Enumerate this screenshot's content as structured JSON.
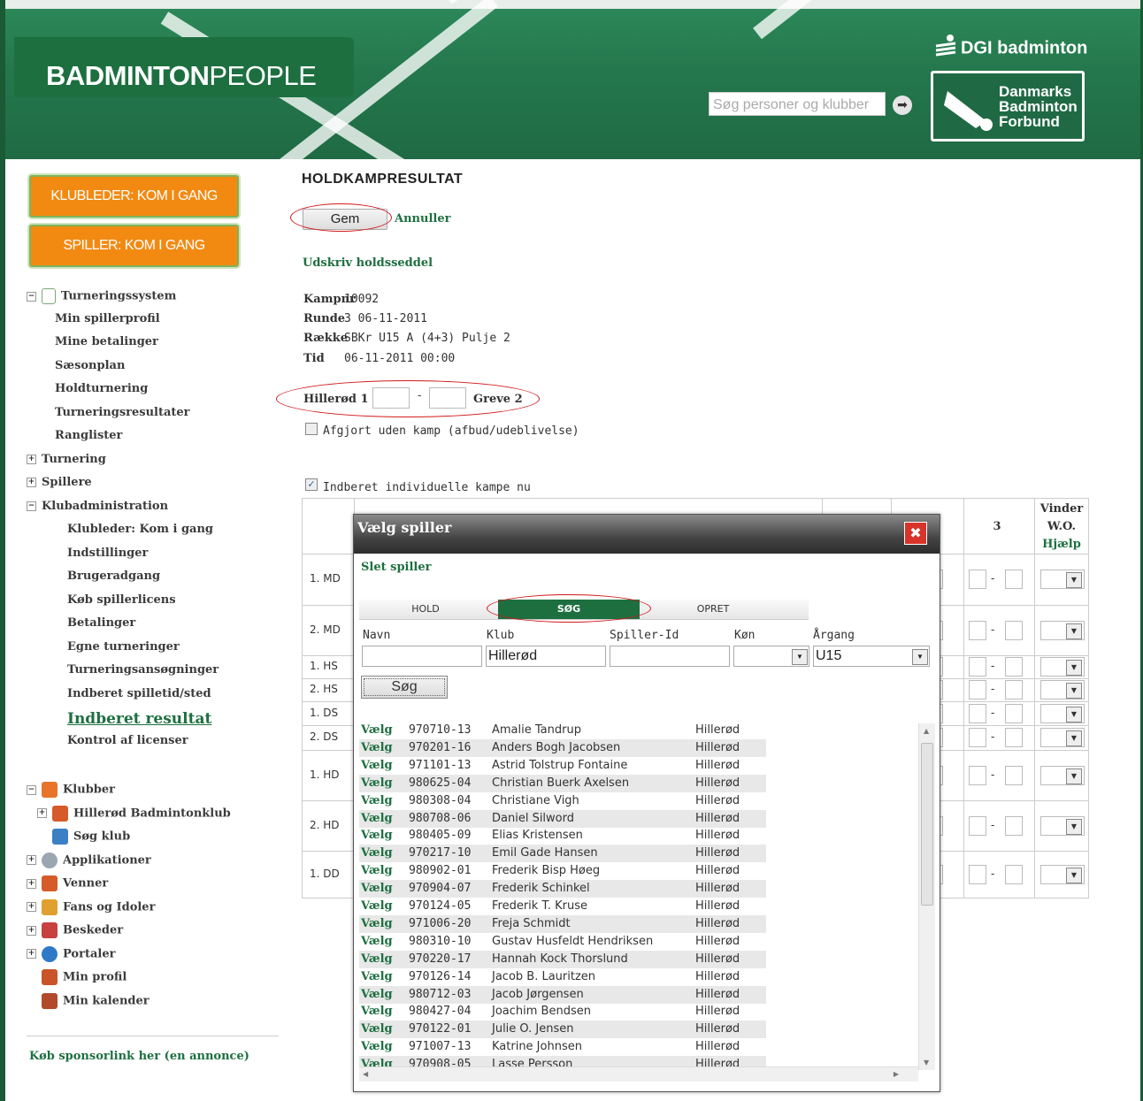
{
  "site": {
    "logo_bold": "BADMINTON",
    "logo_light": "PEOPLE",
    "search_placeholder": "Søg personer og klubber",
    "dgi": "DGI badminton",
    "dbf": "Danmarks\nBadminton\nForbund"
  },
  "sidebar": {
    "btn_klubleder": "KLUBLEDER: KOM I GANG",
    "btn_spiller": "SPILLER: KOM I GANG",
    "tree": [
      {
        "label": "Turneringssystem",
        "level": 0,
        "toggle": "⊟",
        "icon": "calendar-icon"
      },
      {
        "label": "Min spillerprofil",
        "level": 1
      },
      {
        "label": "Mine betalinger",
        "level": 1
      },
      {
        "label": "Sæsonplan",
        "level": 1
      },
      {
        "label": "Holdturnering",
        "level": 1
      },
      {
        "label": "Turneringsresultater",
        "level": 1
      },
      {
        "label": "Ranglister",
        "level": 1
      },
      {
        "label": "Turnering",
        "level": 0,
        "toggle": "⊞"
      },
      {
        "label": "Spillere",
        "level": 0,
        "toggle": "⊞"
      },
      {
        "label": "Klubadministration",
        "level": 0,
        "toggle": "⊟"
      },
      {
        "label": "Klubleder: Kom i gang",
        "level": 2
      },
      {
        "label": "Indstillinger",
        "level": 2
      },
      {
        "label": "Brugeradgang",
        "level": 2
      },
      {
        "label": "Køb spillerlicens",
        "level": 2
      },
      {
        "label": "Betalinger",
        "level": 2
      },
      {
        "label": "Egne turneringer",
        "level": 2
      },
      {
        "label": "Turneringsansøgninger",
        "level": 2
      },
      {
        "label": "Indberet spilletid/sted",
        "level": 2
      },
      {
        "label": "Indberet resultat",
        "level": 2,
        "active": true
      },
      {
        "label": "Kontrol af licenser",
        "level": 2
      }
    ],
    "tree2": [
      {
        "label": "Klubber",
        "toggle": "⊟",
        "icon": "calendar-icon"
      },
      {
        "label": "Hillerød Badmintonklub",
        "toggle": "⊞",
        "icon": "people-icon",
        "indent": true
      },
      {
        "label": "Søg klub",
        "icon": "magnifier-icon",
        "indent": true
      },
      {
        "label": "Applikationer",
        "toggle": "⊞",
        "icon": "disc-icon"
      },
      {
        "label": "Venner",
        "toggle": "⊞",
        "icon": "people-icon"
      },
      {
        "label": "Fans og Idoler",
        "toggle": "⊞",
        "icon": "thumbs-up-icon"
      },
      {
        "label": "Beskeder",
        "toggle": "⊞",
        "icon": "message-icon"
      },
      {
        "label": "Portaler",
        "toggle": "⊞",
        "icon": "globe-icon"
      },
      {
        "label": "Min profil",
        "icon": "person-icon"
      },
      {
        "label": "Min kalender",
        "icon": "calendar-day-icon"
      }
    ],
    "sponsor": "Køb sponsorlink her (en annonce)"
  },
  "main": {
    "title": "HOLDKAMPRESULTAT",
    "gem": "Gem",
    "annuller": "Annuller",
    "udskriv": "Udskriv holdsseddel",
    "info": [
      {
        "k": "Kampnr",
        "v": "10092"
      },
      {
        "k": "Runde",
        "v": "3 06-11-2011"
      },
      {
        "k": "Række",
        "v": "SBKr U15 A (4+3) Pulje 2"
      },
      {
        "k": "Tid",
        "v": "06-11-2011 00:00"
      }
    ],
    "home_team": "Hillerød 1",
    "away_team": "Greve 2",
    "score_sep": "-",
    "afgjort": "Afgjort uden kamp (afbud/udeblivelse)",
    "indberet": "Indberet individuelle kampe nu",
    "table": {
      "col3": "3",
      "vinder": "Vinder",
      "wo": "W.O.",
      "hjaelp": "Hjælp",
      "rows": [
        "1. MD",
        "2. MD",
        "1. HS",
        "2. HS",
        "1. DS",
        "2. DS",
        "1. HD",
        "2. HD",
        "1. DD"
      ]
    }
  },
  "dialog": {
    "title": "Vælg spiller",
    "slet": "Slet spiller",
    "tabs": [
      "HOLD",
      "SØG",
      "OPRET"
    ],
    "active_tab": "SØG",
    "labels": {
      "navn": "Navn",
      "klub": "Klub",
      "spillerid": "Spiller-Id",
      "kon": "Køn",
      "argang": "Årgang"
    },
    "values": {
      "navn": "",
      "klub": "Hillerød",
      "spillerid": "",
      "kon": "",
      "argang": "U15"
    },
    "sog_btn": "Søg",
    "choose": "Vælg",
    "players": [
      {
        "id": "970710-13",
        "name": "Amalie Tandrup",
        "club": "Hillerød"
      },
      {
        "id": "970201-16",
        "name": "Anders Bogh Jacobsen",
        "club": "Hillerød"
      },
      {
        "id": "971101-13",
        "name": "Astrid Tolstrup Fontaine",
        "club": "Hillerød"
      },
      {
        "id": "980625-04",
        "name": "Christian Buerk Axelsen",
        "club": "Hillerød"
      },
      {
        "id": "980308-04",
        "name": "Christiane Vigh",
        "club": "Hillerød"
      },
      {
        "id": "980708-06",
        "name": "Daniel Silword",
        "club": "Hillerød"
      },
      {
        "id": "980405-09",
        "name": "Elias Kristensen",
        "club": "Hillerød"
      },
      {
        "id": "970217-10",
        "name": "Emil Gade Hansen",
        "club": "Hillerød"
      },
      {
        "id": "980902-01",
        "name": "Frederik Bisp Høeg",
        "club": "Hillerød"
      },
      {
        "id": "970904-07",
        "name": "Frederik Schinkel",
        "club": "Hillerød"
      },
      {
        "id": "970124-05",
        "name": "Frederik T. Kruse",
        "club": "Hillerød"
      },
      {
        "id": "971006-20",
        "name": "Freja Schmidt",
        "club": "Hillerød"
      },
      {
        "id": "980310-10",
        "name": "Gustav Husfeldt Hendriksen",
        "club": "Hillerød"
      },
      {
        "id": "970220-17",
        "name": "Hannah Kock Thorslund",
        "club": "Hillerød"
      },
      {
        "id": "970126-14",
        "name": "Jacob B. Lauritzen",
        "club": "Hillerød"
      },
      {
        "id": "980712-03",
        "name": "Jacob Jørgensen",
        "club": "Hillerød"
      },
      {
        "id": "980427-04",
        "name": "Joachim Bendsen",
        "club": "Hillerød"
      },
      {
        "id": "970122-01",
        "name": "Julie O. Jensen",
        "club": "Hillerød"
      },
      {
        "id": "971007-13",
        "name": "Katrine Johnsen",
        "club": "Hillerød"
      },
      {
        "id": "970908-05",
        "name": "Lasse Persson",
        "club": "Hillerød"
      }
    ]
  },
  "colors": {
    "brand_green": "#1d6f40",
    "orange": "#f28a12",
    "annotation_red": "#d21919"
  }
}
